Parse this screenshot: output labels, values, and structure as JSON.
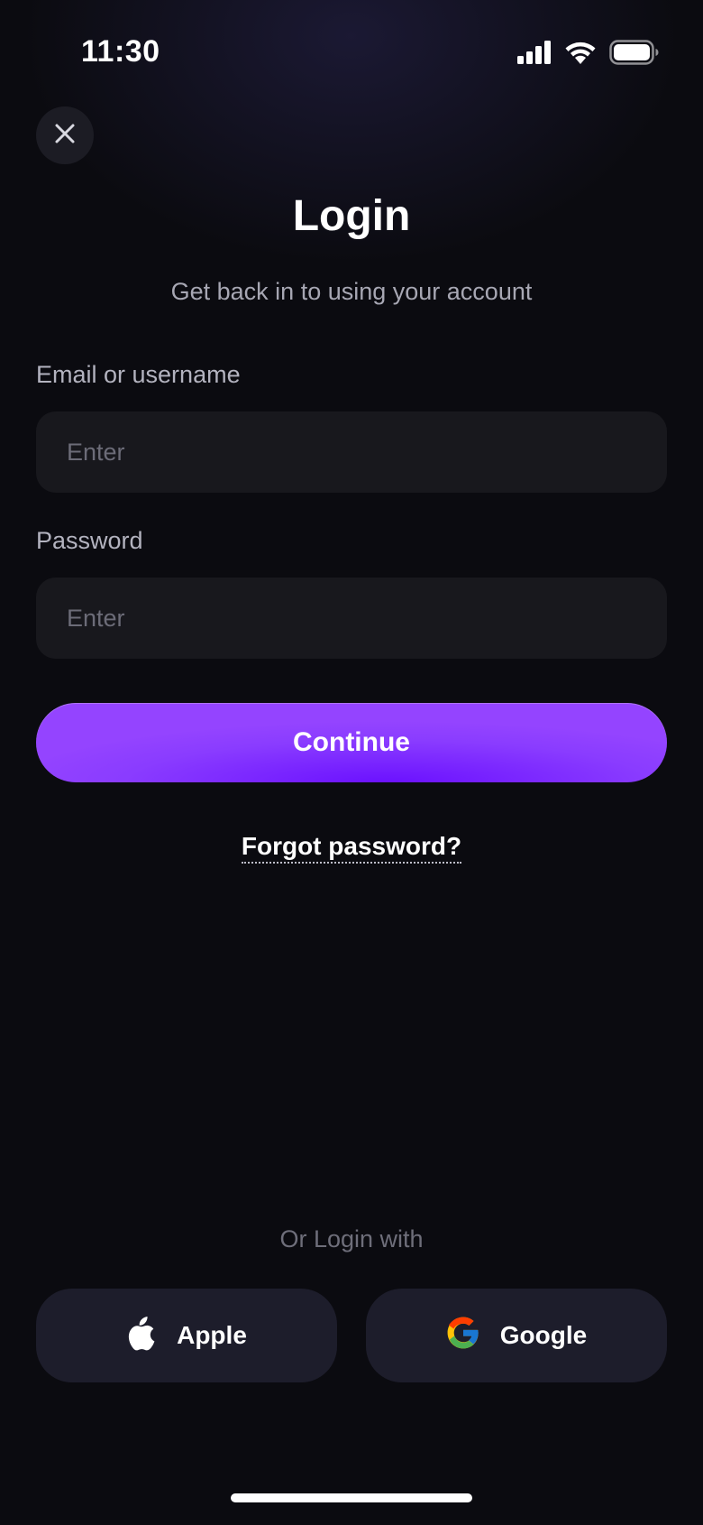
{
  "status_bar": {
    "time": "11:30",
    "icons": [
      "cellular-signal-icon",
      "wifi-icon",
      "battery-icon"
    ]
  },
  "header": {
    "close_icon": "close-icon",
    "title": "Login",
    "subtitle": "Get back in to using your account"
  },
  "form": {
    "email": {
      "label": "Email or username",
      "placeholder": "Enter",
      "value": ""
    },
    "password": {
      "label": "Password",
      "placeholder": "Enter",
      "value": ""
    },
    "continue_label": "Continue",
    "forgot_label": "Forgot password?"
  },
  "social": {
    "divider_label": "Or Login with",
    "apple_label": "Apple",
    "google_label": "Google"
  },
  "colors": {
    "background": "#0b0b10",
    "accent": "#7a22ff",
    "field_background": "#18181d",
    "social_button_background": "#1d1d2b"
  }
}
